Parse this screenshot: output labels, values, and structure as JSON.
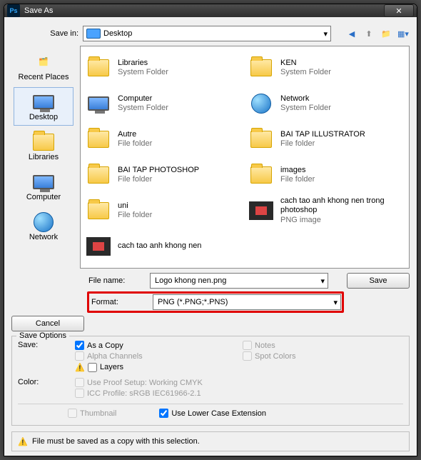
{
  "title": "Save As",
  "savein": {
    "label": "Save in:",
    "value": "Desktop"
  },
  "places": [
    {
      "label": "Recent Places"
    },
    {
      "label": "Desktop"
    },
    {
      "label": "Libraries"
    },
    {
      "label": "Computer"
    },
    {
      "label": "Network"
    }
  ],
  "files": [
    {
      "name": "Libraries",
      "sub": "System Folder",
      "icon": "folder"
    },
    {
      "name": "KEN",
      "sub": "System Folder",
      "icon": "folder"
    },
    {
      "name": "Computer",
      "sub": "System Folder",
      "icon": "monitor"
    },
    {
      "name": "Network",
      "sub": "System Folder",
      "icon": "globe"
    },
    {
      "name": "Autre",
      "sub": "File folder",
      "icon": "folder"
    },
    {
      "name": "BAI TAP ILLUSTRATOR",
      "sub": "File folder",
      "icon": "folder"
    },
    {
      "name": "BAI TAP PHOTOSHOP",
      "sub": "File folder",
      "icon": "folder"
    },
    {
      "name": "images",
      "sub": "File folder",
      "icon": "folder"
    },
    {
      "name": "uni",
      "sub": "File folder",
      "icon": "folder"
    },
    {
      "name": "cach tao anh khong nen trong photoshop",
      "sub": "PNG image",
      "icon": "thumb"
    },
    {
      "name": "cach tao anh khong nen",
      "sub": "",
      "icon": "thumb"
    }
  ],
  "filename": {
    "label": "File name:",
    "value": "Logo khong nen.png"
  },
  "format": {
    "label": "Format:",
    "value": "PNG (*.PNG;*.PNS)"
  },
  "buttons": {
    "save": "Save",
    "cancel": "Cancel"
  },
  "saveoptions": {
    "legend": "Save Options",
    "saveLabel": "Save:",
    "asCopy": "As a Copy",
    "alpha": "Alpha Channels",
    "layers": "Layers",
    "notes": "Notes",
    "spot": "Spot Colors",
    "colorLabel": "Color:",
    "proof": "Use Proof Setup:  Working CMYK",
    "icc": "ICC Profile:  sRGB IEC61966-2.1",
    "thumb": "Thumbnail",
    "lower": "Use Lower Case Extension"
  },
  "infoMsg": "File must be saved as a copy with this selection."
}
